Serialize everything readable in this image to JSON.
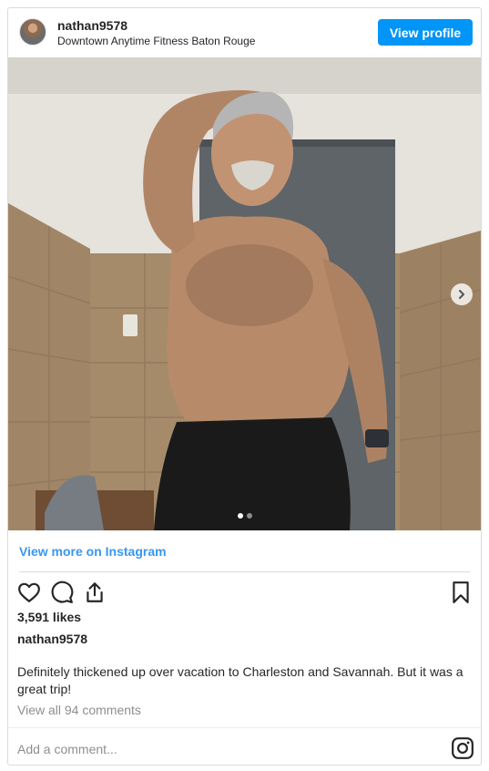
{
  "header": {
    "username": "nathan9578",
    "location": "Downtown Anytime Fitness Baton Rouge",
    "view_profile_label": "View profile"
  },
  "photo": {
    "slide_count": 2,
    "active_slide": 1,
    "next_arrow_icon": "chevron-right-icon"
  },
  "links": {
    "view_more": "View more on Instagram"
  },
  "actions": {
    "icons": [
      "heart-icon",
      "comment-icon",
      "share-icon",
      "bookmark-icon"
    ]
  },
  "post": {
    "likes": "3,591 likes",
    "owner": "nathan9578",
    "caption": "Definitely thickened up over vacation to Charleston and Savannah. But it was a great trip!",
    "view_comments": "View all 94 comments"
  },
  "comment_box": {
    "placeholder": "Add a comment...",
    "icon": "instagram-icon"
  },
  "colors": {
    "accent": "#0095f6",
    "link": "#3897f0",
    "muted": "#8e8e8e",
    "border": "#dbdbdb"
  }
}
